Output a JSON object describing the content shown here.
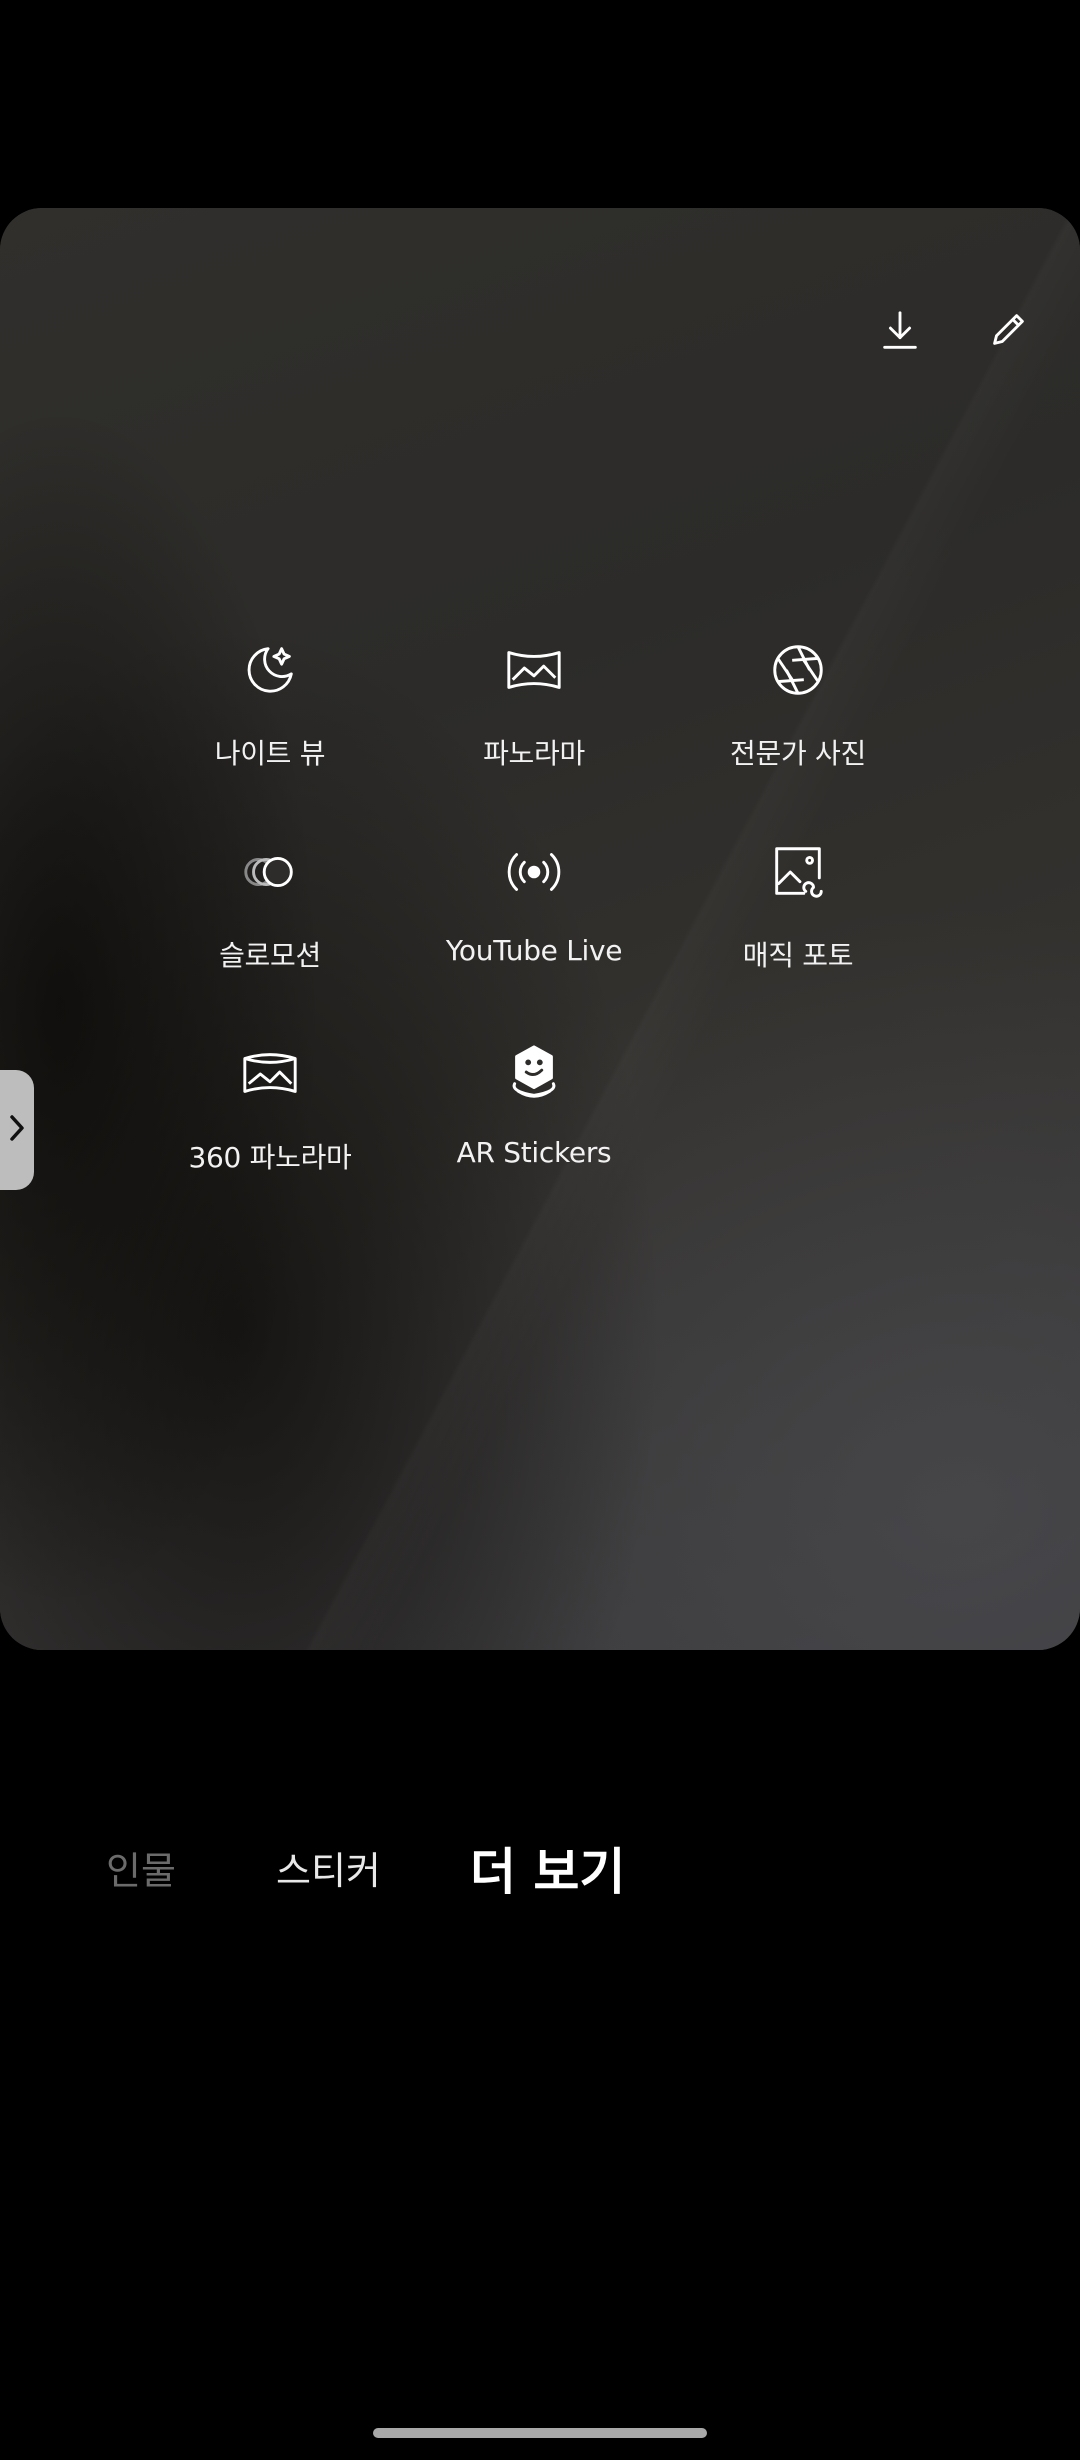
{
  "top_actions": {
    "download_icon": "download-icon",
    "edit_icon": "pencil-icon"
  },
  "modes": [
    {
      "label": "나이트 뷰",
      "icon": "moon-star-icon"
    },
    {
      "label": "파노라마",
      "icon": "panorama-icon"
    },
    {
      "label": "전문가 사진",
      "icon": "aperture-icon"
    },
    {
      "label": "슬로모션",
      "icon": "slow-motion-icon"
    },
    {
      "label": "YouTube Live",
      "icon": "broadcast-icon"
    },
    {
      "label": "매직 포토",
      "icon": "magic-photo-icon"
    },
    {
      "label": "360 파노라마",
      "icon": "panorama-360-icon"
    },
    {
      "label": "AR Stickers",
      "icon": "ar-stickers-icon"
    }
  ],
  "side_handle": {
    "icon": "chevron-right-icon"
  },
  "mode_tabs": [
    {
      "label": "인물",
      "state": "dim"
    },
    {
      "label": "스티커",
      "state": "normal"
    },
    {
      "label": "더 보기",
      "state": "active"
    }
  ]
}
